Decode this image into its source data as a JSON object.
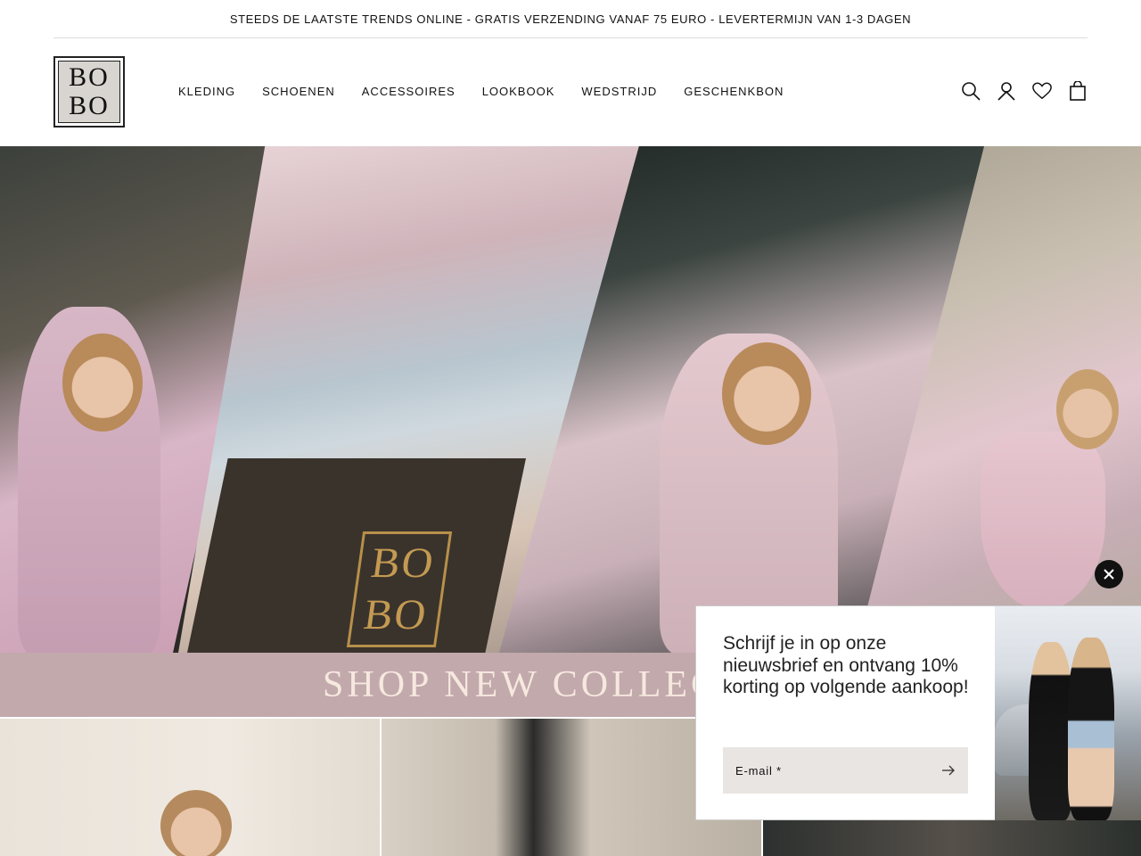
{
  "announcement": "STEEDS DE LAATSTE TRENDS ONLINE - GRATIS VERZENDING VANAF 75 EURO - LEVERTERMIJN VAN 1-3 DAGEN",
  "logo": {
    "line1": "BO",
    "line2": "BO"
  },
  "nav": [
    "KLEDING",
    "SCHOENEN",
    "ACCESSOIRES",
    "LOOKBOOK",
    "WEDSTRIJD",
    "GESCHENKBON"
  ],
  "header_icons": [
    "search-icon",
    "account-icon",
    "wishlist-icon",
    "cart-icon"
  ],
  "hero": {
    "bag_logo_line1": "BO",
    "bag_logo_line2": "BO"
  },
  "banner": {
    "text": "SHOP NEW COLLEC"
  },
  "popup": {
    "text": "Schrijf je in op onze nieuwsbrief en ontvang 10% korting op volgende aankoop!",
    "email_label": "E-mail *"
  },
  "colors": {
    "banner": "#c2a9ac",
    "banner_text": "#f6e8df",
    "field_bg": "#e9e5e2"
  }
}
